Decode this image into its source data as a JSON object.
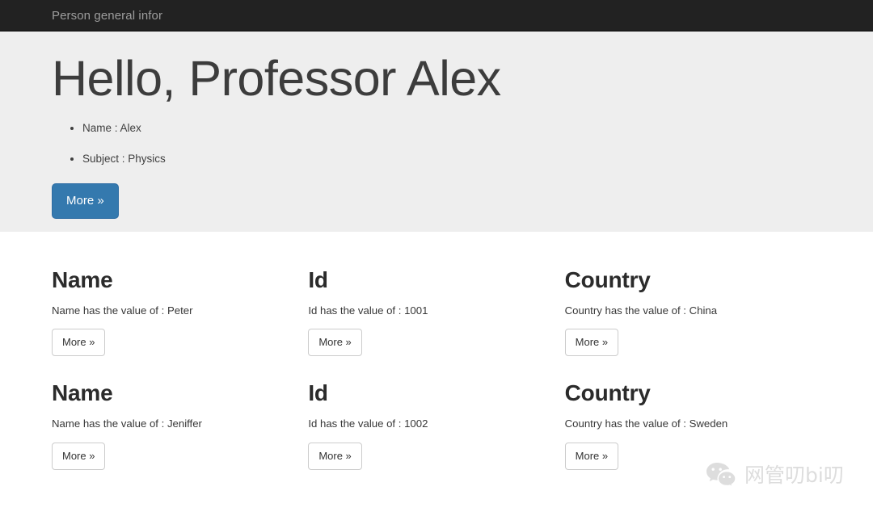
{
  "navbar": {
    "brand": "Person general infor"
  },
  "hero": {
    "title": "Hello, Professor Alex",
    "items": [
      "Name : Alex",
      "Subject : Physics"
    ],
    "button_label": "More »"
  },
  "columns": [
    [
      {
        "title": "Name",
        "text": "Name has the value of : Peter",
        "button_label": "More »"
      },
      {
        "title": "Id",
        "text": "Id has the value of : 1001",
        "button_label": "More »"
      },
      {
        "title": "Country",
        "text": "Country has the value of : China",
        "button_label": "More »"
      }
    ],
    [
      {
        "title": "Name",
        "text": "Name has the value of : Jeniffer",
        "button_label": "More »"
      },
      {
        "title": "Id",
        "text": "Id has the value of : 1002",
        "button_label": "More »"
      },
      {
        "title": "Country",
        "text": "Country has the value of : Sweden",
        "button_label": "More »"
      }
    ]
  ],
  "watermark": {
    "icon": "wechat-icon",
    "text": "网管叨bi叨"
  },
  "colors": {
    "navbar_bg": "#222222",
    "navbar_text": "#9d9d9d",
    "jumbotron_bg": "#eeeeee",
    "primary_button": "#3479ae",
    "page_bg": "#ffffff",
    "body_text": "#333333"
  }
}
